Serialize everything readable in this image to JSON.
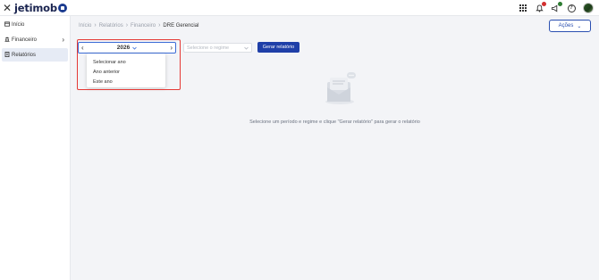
{
  "app": {
    "logo_text": "jetimob",
    "brand_color": "#1b3b8f",
    "accent_color": "#1f3fa8"
  },
  "topbar": {
    "close_icon": "close-icon",
    "icons": [
      "apps-grid-icon",
      "notifications-icon",
      "announcements-icon",
      "help-icon",
      "avatar"
    ]
  },
  "sidebar": {
    "items": [
      {
        "label": "Início",
        "icon": "home-icon"
      },
      {
        "label": "Financeiro",
        "icon": "bank-icon",
        "expandable": true
      },
      {
        "label": "Relatórios",
        "icon": "document-icon",
        "active": true
      }
    ]
  },
  "breadcrumb": {
    "items": [
      "Início",
      "Relatórios",
      "Financeiro",
      "DRE Gerencial"
    ]
  },
  "header": {
    "actions_label": "Ações"
  },
  "filters": {
    "year_value": "2026",
    "regime_placeholder": "Selecione o regime",
    "generate_label": "Gerar relatório"
  },
  "year_dropdown": {
    "options": [
      "Selecionar ano",
      "Ano anterior",
      "Este ano"
    ]
  },
  "empty_state": {
    "message": "Selecione um período e regime e clique \"Gerar relatório\" para gerar o relatório"
  }
}
